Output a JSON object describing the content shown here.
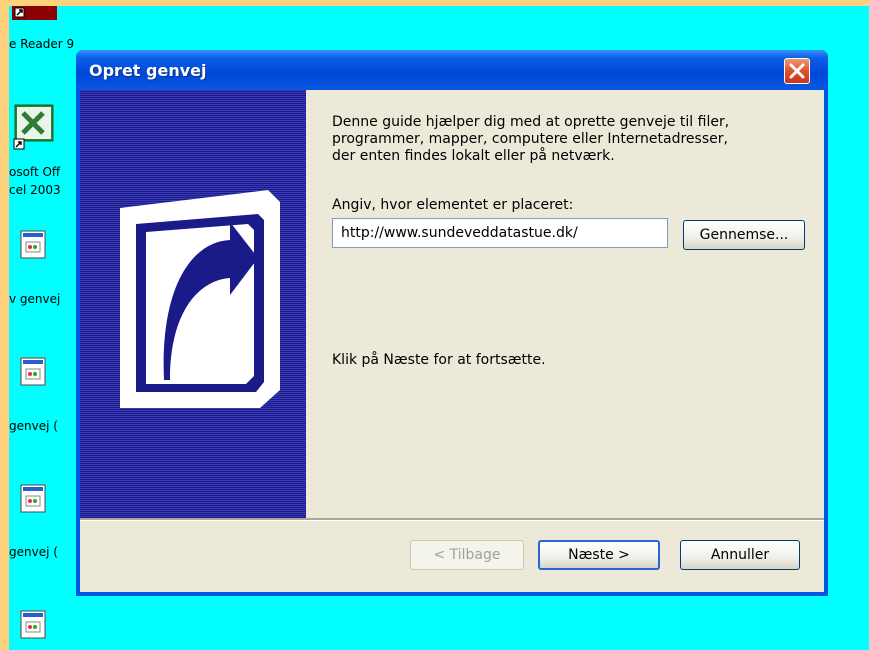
{
  "desktop": {
    "icon_labels": [
      "e Reader 9",
      "osoft Off",
      "cel 2003",
      "v genvej",
      "genvej (",
      "genvej ("
    ]
  },
  "dialog": {
    "title": "Opret genvej",
    "intro_line1": "Denne guide hjælper dig med at oprette genveje til filer,",
    "intro_line2": "programmer, mapper, computere eller Internetadresser,",
    "intro_line3": "der enten findes lokalt eller på netværk.",
    "location_prompt": "Angiv, hvor elementet er placeret:",
    "location_value": "http://www.sundeveddatastue.dk/",
    "browse_label": "Gennemse...",
    "continue_text": "Klik på Næste for at fortsætte.",
    "back_label": "< Tilbage",
    "next_label": "Næste >",
    "cancel_label": "Annuller"
  },
  "colors": {
    "desktop_background": "#00ffff",
    "titlebar": "#0054e3",
    "dialog_face": "#ece9d8",
    "side_panel": "#2a2aa0"
  }
}
